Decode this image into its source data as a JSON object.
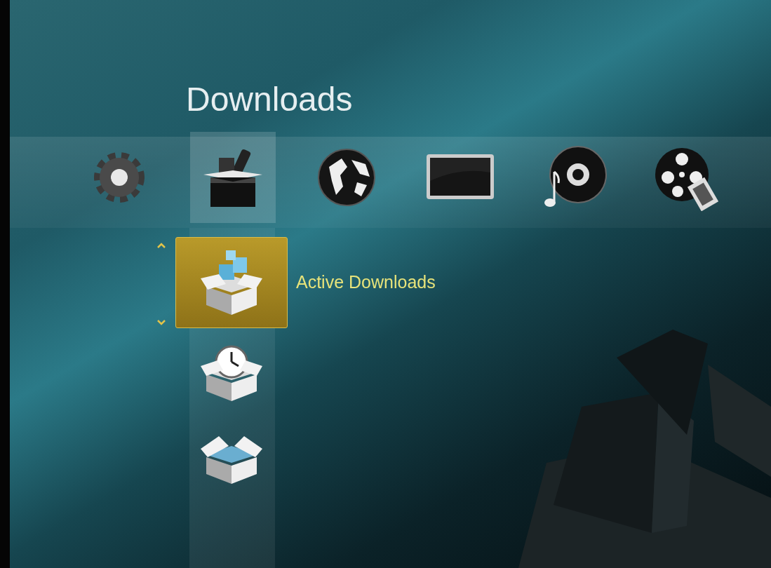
{
  "title": "Downloads",
  "categories": [
    {
      "kind": "settings",
      "selected": false
    },
    {
      "kind": "downloads",
      "selected": true
    },
    {
      "kind": "internet",
      "selected": false
    },
    {
      "kind": "tv",
      "selected": false
    },
    {
      "kind": "music",
      "selected": false
    },
    {
      "kind": "video",
      "selected": false
    }
  ],
  "submenu": [
    {
      "kind": "active",
      "label": "Active Downloads",
      "selected": true
    },
    {
      "kind": "scheduled",
      "selected": false
    },
    {
      "kind": "completed",
      "selected": false
    }
  ]
}
